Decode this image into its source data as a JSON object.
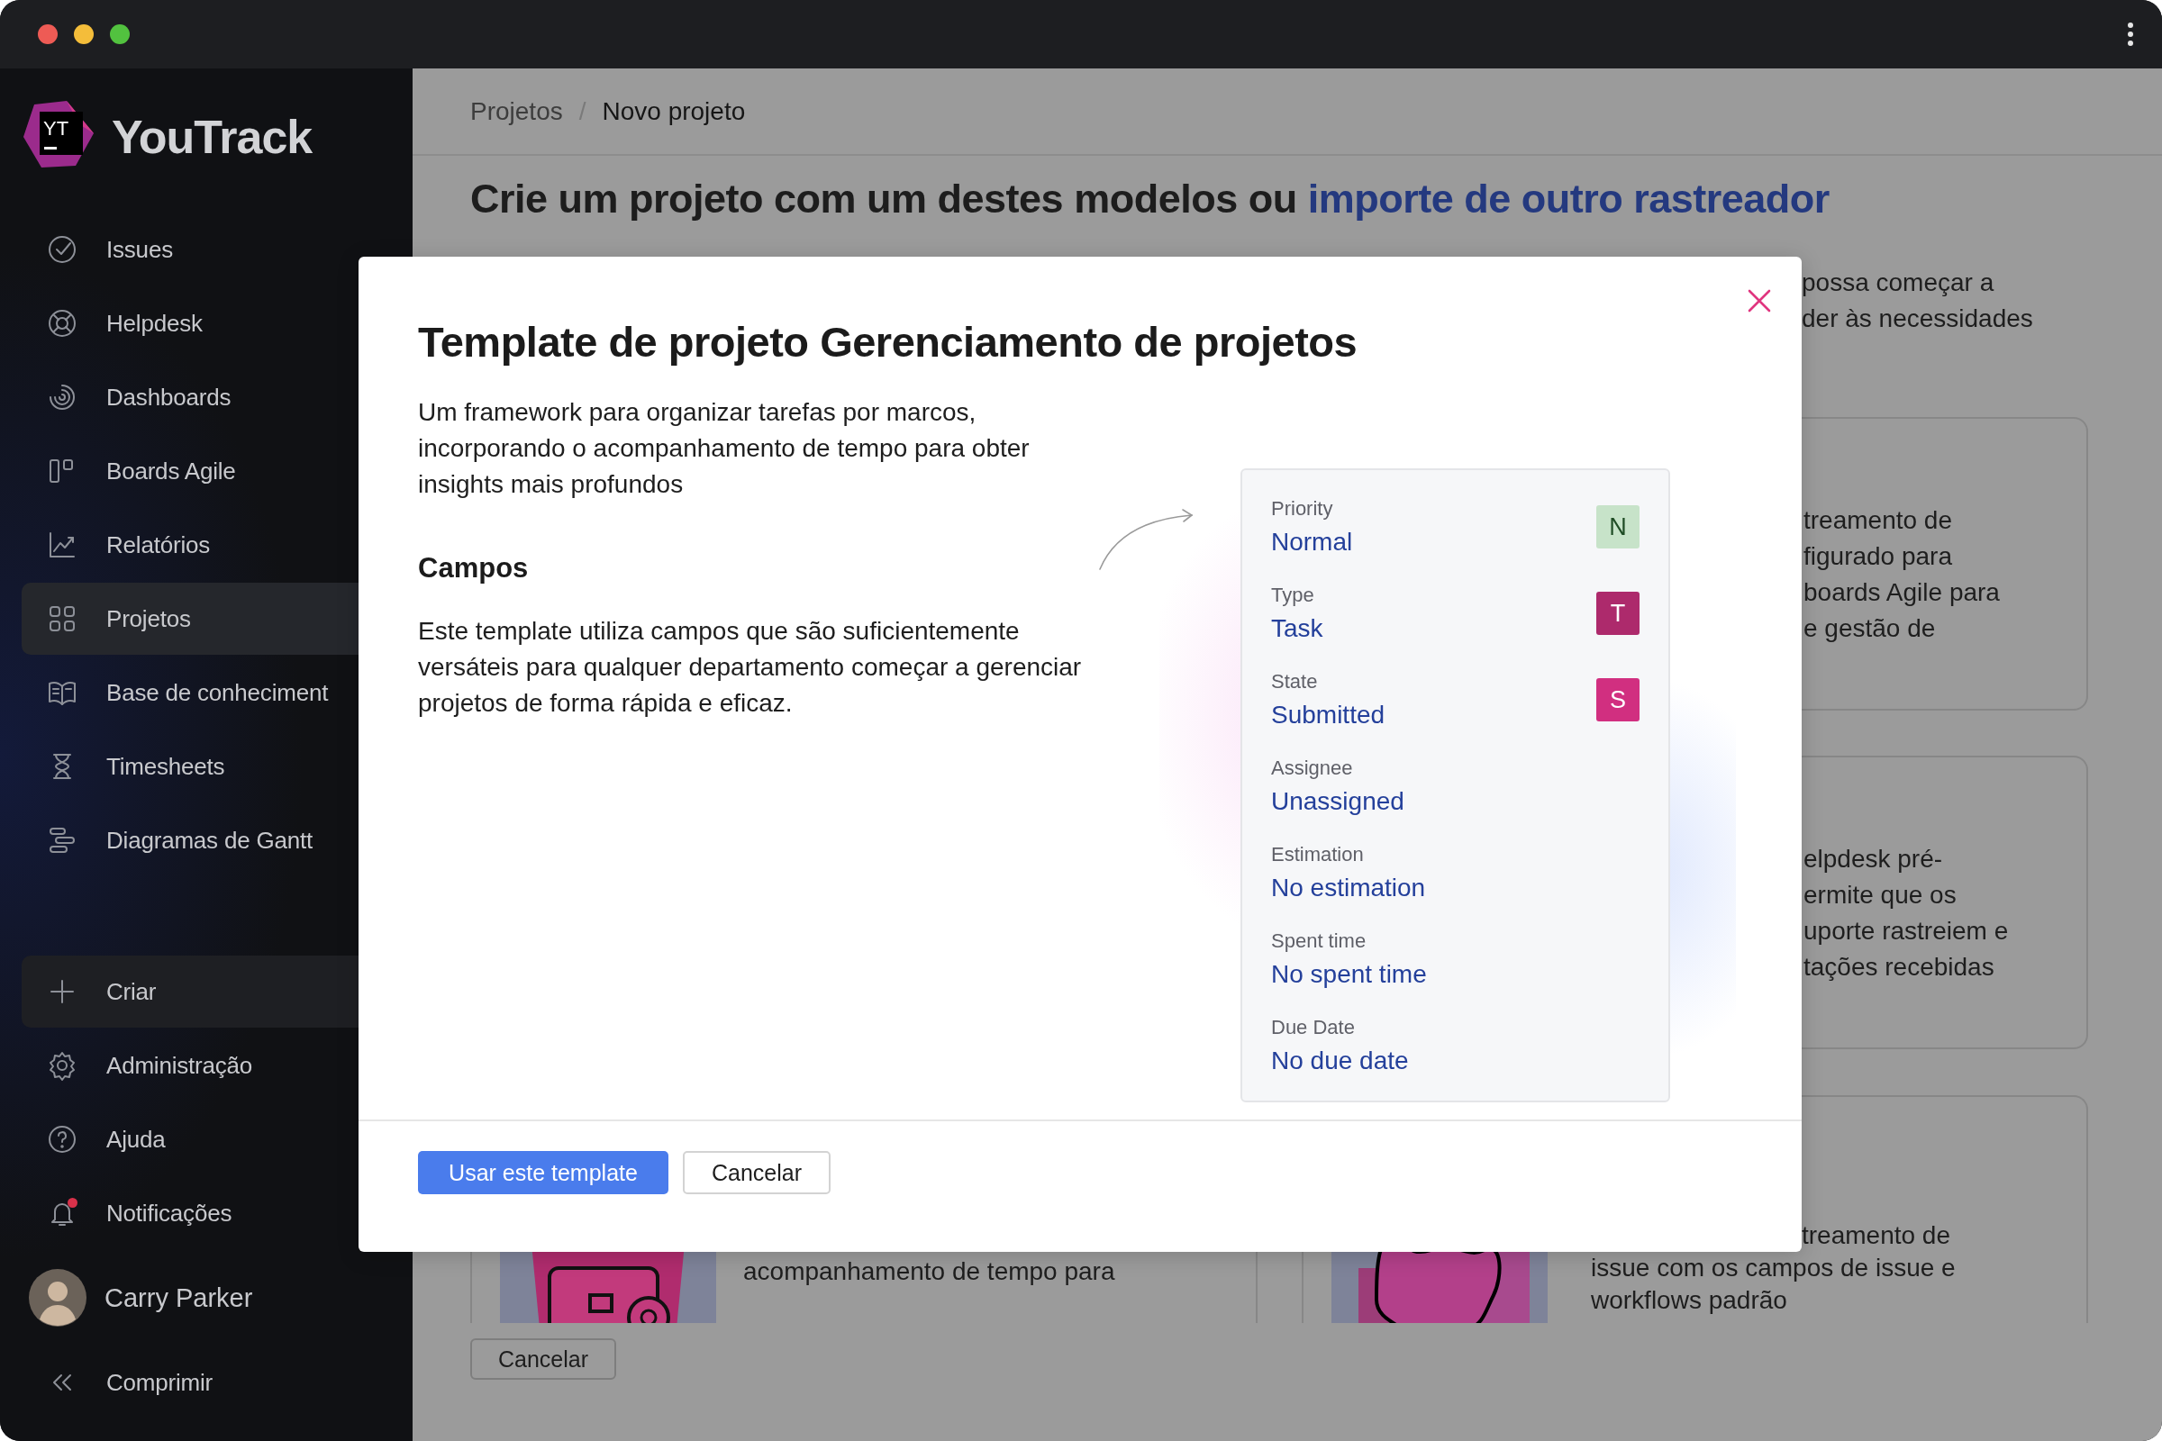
{
  "sidebar": {
    "logo_mark": "YT",
    "brand": "YouTrack",
    "nav": [
      {
        "label": "Issues",
        "selected": false
      },
      {
        "label": "Helpdesk",
        "selected": false
      },
      {
        "label": "Dashboards",
        "selected": false
      },
      {
        "label": "Boards Agile",
        "selected": false
      },
      {
        "label": "Relatórios",
        "selected": false
      },
      {
        "label": "Projetos",
        "selected": true
      },
      {
        "label": "Base de conheciment",
        "selected": false
      },
      {
        "label": "Timesheets",
        "selected": false
      },
      {
        "label": "Diagramas de Gantt",
        "selected": false
      }
    ],
    "actions": [
      {
        "label": "Criar",
        "kind": "create",
        "unread": false
      },
      {
        "label": "Administração",
        "kind": "link",
        "unread": false
      },
      {
        "label": "Ajuda",
        "kind": "link",
        "unread": false
      },
      {
        "label": "Notificações",
        "kind": "link",
        "unread": true
      }
    ],
    "user": {
      "name": "Carry Parker"
    },
    "collapse": "Comprimir"
  },
  "main": {
    "breadcrumb": [
      {
        "label": "Projetos",
        "current": false
      },
      {
        "label": "Novo projeto",
        "current": true
      }
    ],
    "breadcrumb_separator": "/",
    "heading": {
      "text": "Crie um projeto com um destes modelos ou",
      "link": "importe de outro rastreador"
    },
    "intro_fragments": [
      "possa começar a",
      "der às necessidades"
    ],
    "cards": [
      {
        "clipped_lines": [
          "treamento de",
          "figurado para",
          "boards Agile para",
          "e gestão de"
        ]
      },
      {
        "clipped_lines": [
          "elpdesk pré-",
          "ermite que os",
          "uporte rastreiem e",
          "tações recebidas"
        ]
      }
    ],
    "bottom_cards": [
      {
        "kind": "picture",
        "lines": [
          "acompanhamento de tempo para"
        ]
      },
      {
        "kind": "picture",
        "clipped_lines": [
          "treamento de"
        ],
        "lines": [
          "issue com os campos de issue e",
          "workflows padrão"
        ]
      }
    ],
    "cancel": "Cancelar"
  },
  "dialog": {
    "title": "Template de projeto Gerenciamento de projetos",
    "description": "Um framework para organizar tarefas por marcos, incorporando o acompanhamento de tempo para obter insights mais profundos",
    "section_title": "Campos",
    "section_text": "Este template utiliza campos que são suficientemente versáteis para qualquer departamento começar a gerenciar projetos de forma rápida e eficaz.",
    "fields": [
      {
        "label": "Priority",
        "value": "Normal",
        "badge": "N",
        "color": "#c7e3c9"
      },
      {
        "label": "Type",
        "value": "Task",
        "badge": "T",
        "color": "#ad2a6c"
      },
      {
        "label": "State",
        "value": "Submitted",
        "badge": "S",
        "color": "#d12f80"
      },
      {
        "label": "Assignee",
        "value": "Unassigned"
      },
      {
        "label": "Estimation",
        "value": "No estimation"
      },
      {
        "label": "Spent time",
        "value": "No spent time"
      },
      {
        "label": "Due Date",
        "value": "No due date"
      }
    ],
    "primary_button": "Usar este template",
    "secondary_button": "Cancelar"
  }
}
